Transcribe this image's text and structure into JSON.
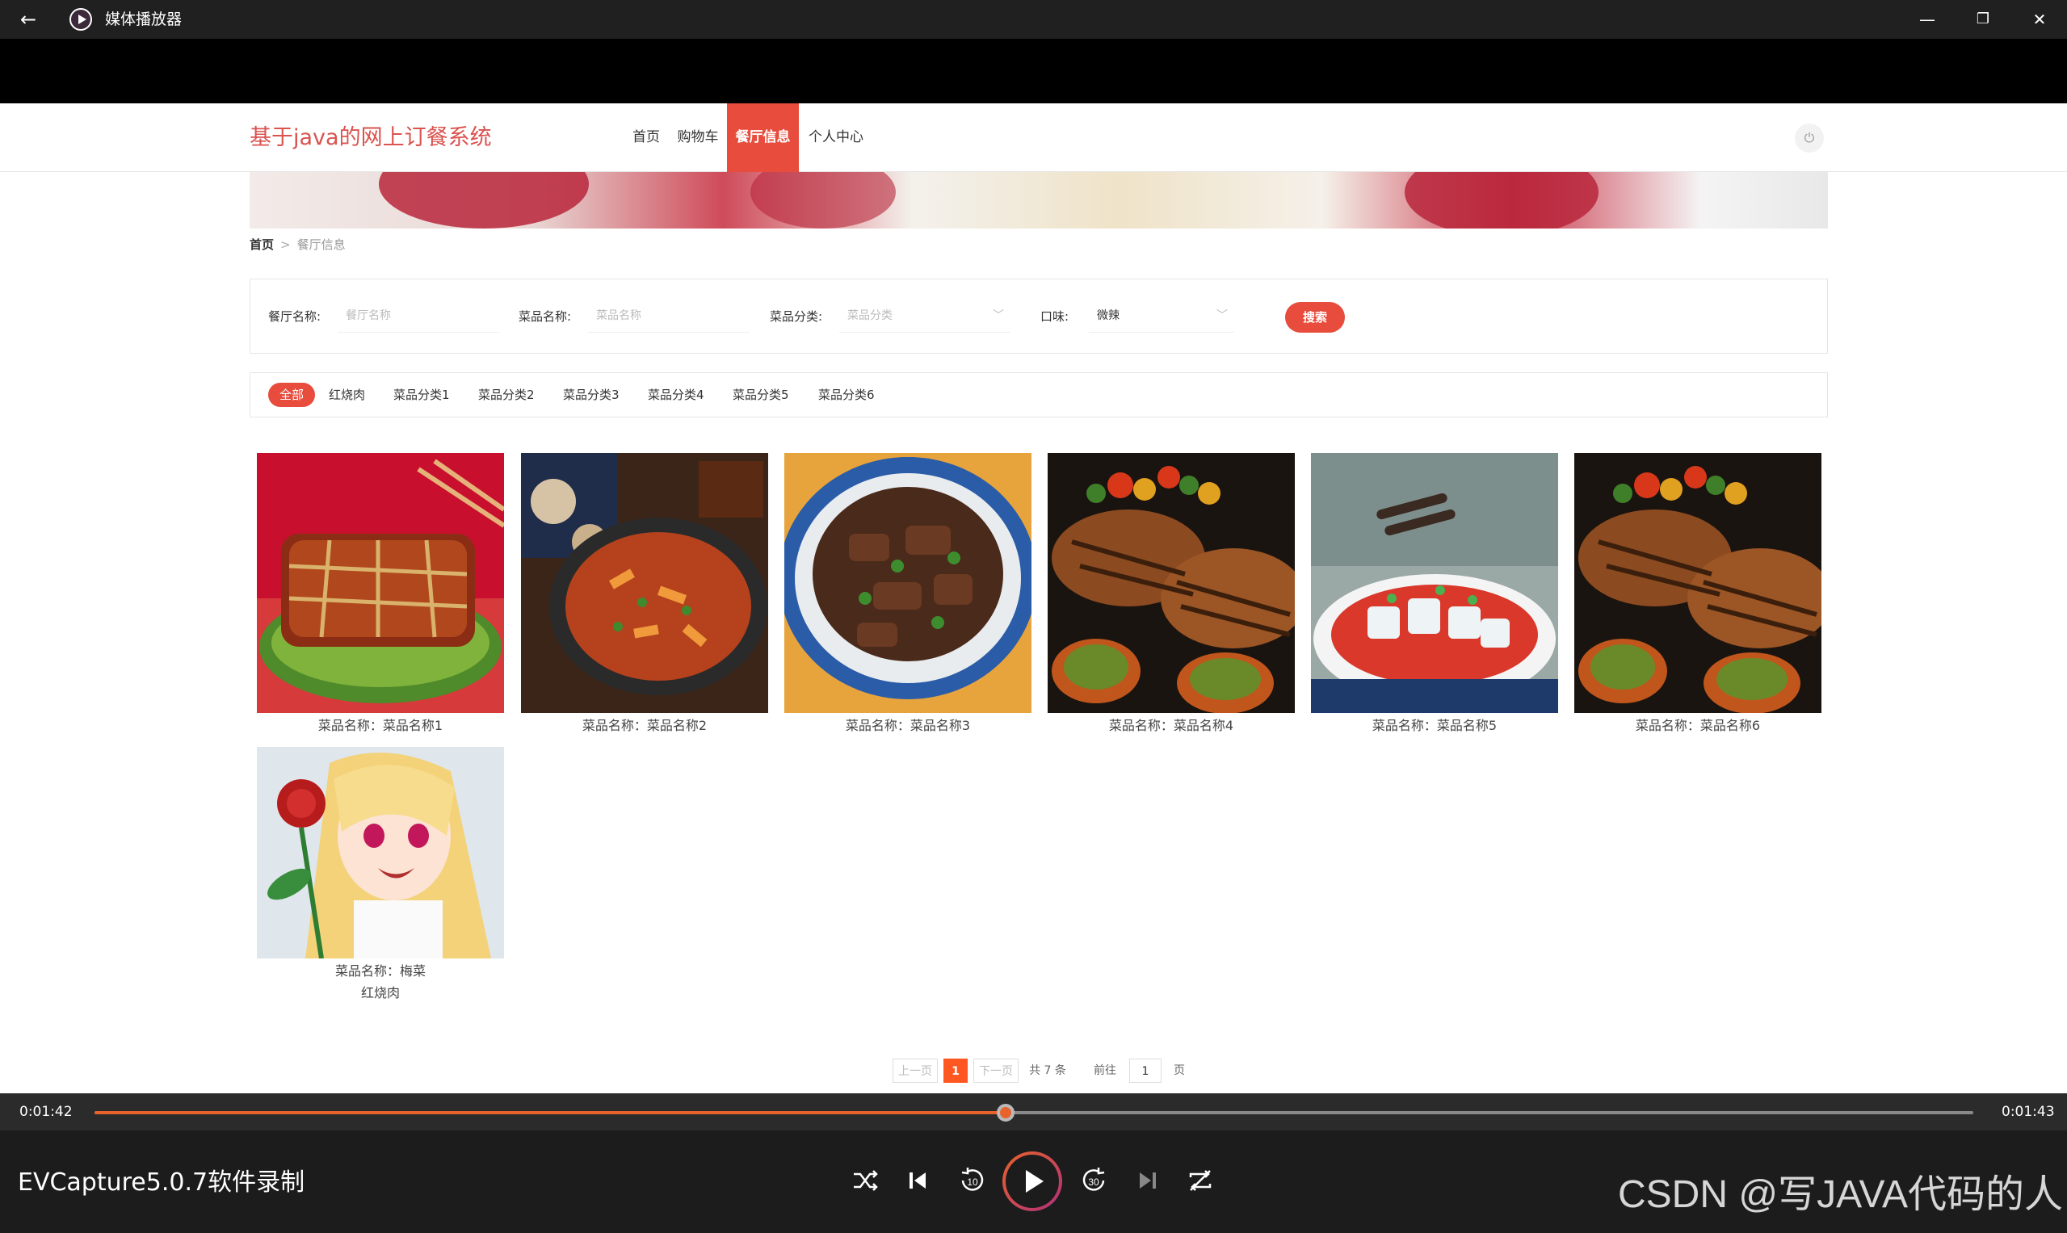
{
  "window": {
    "title": "媒体播放器",
    "back_glyph": "←",
    "min_glyph": "—",
    "max_glyph": "❐",
    "close_glyph": "✕"
  },
  "site": {
    "title": "基于java的网上订餐系统",
    "nav": [
      {
        "label": "首页"
      },
      {
        "label": "购物车"
      },
      {
        "label": "餐厅信息",
        "active": true
      },
      {
        "label": "个人中心"
      }
    ],
    "power_glyph": "⏻"
  },
  "breadcrumb": {
    "home": "首页",
    "sep": ">",
    "current": "餐厅信息"
  },
  "search": {
    "fields": [
      {
        "label": "餐厅名称:",
        "placeholder": "餐厅名称"
      },
      {
        "label": "菜品名称:",
        "placeholder": "菜品名称"
      },
      {
        "label": "菜品分类:",
        "placeholder": "菜品分类"
      },
      {
        "label": "口味:",
        "value": "微辣"
      }
    ],
    "chevron": "﹀",
    "button": "搜索"
  },
  "categories": [
    "全部",
    "红烧肉",
    "菜品分类1",
    "菜品分类2",
    "菜品分类3",
    "菜品分类4",
    "菜品分类5",
    "菜品分类6"
  ],
  "dishes": [
    {
      "name": "菜品名称：菜品名称1",
      "image": "braised-pork-image"
    },
    {
      "name": "菜品名称：菜品名称2",
      "image": "spicy-stirfry-image"
    },
    {
      "name": "菜品名称：菜品名称3",
      "image": "braised-meat-bowl-image"
    },
    {
      "name": "菜品名称：菜品名称4",
      "image": "grilled-steak-image"
    },
    {
      "name": "菜品名称：菜品名称5",
      "image": "jelly-noodles-image"
    },
    {
      "name": "菜品名称：菜品名称6",
      "image": "grilled-steak-image"
    },
    {
      "name": "菜品名称：梅菜",
      "sub": "红烧肉",
      "image": "anime-girl-rose-image"
    }
  ],
  "pager": {
    "prev": "上一页",
    "current": "1",
    "next": "下一页",
    "total": "共 7 条",
    "goto": "前往",
    "page_input": "1",
    "page_unit": "页"
  },
  "player": {
    "time_current": "0:01:42",
    "time_total": "0:01:43",
    "progress": 0.485,
    "media_title": "EVCapture5.0.7软件录制",
    "watermark": "CSDN @写JAVA代码的人",
    "accent": "#e8632b"
  }
}
